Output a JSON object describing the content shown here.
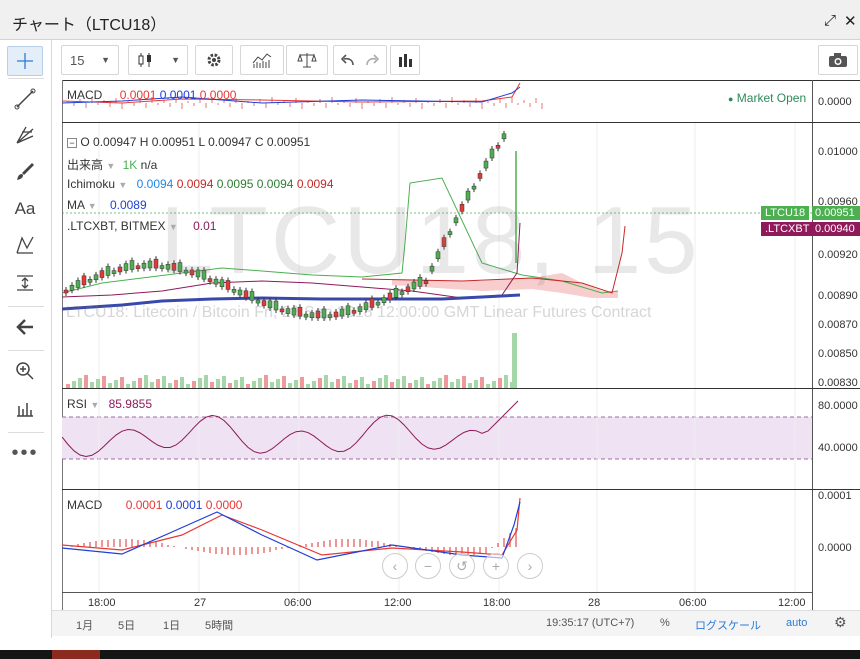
{
  "window": {
    "title": "チャート（LTCU18）"
  },
  "toolbar": {
    "interval": "15",
    "icons": [
      "candles-icon",
      "settings-icon",
      "indicators-icon",
      "compare-icon",
      "undo-icon",
      "redo-icon",
      "bar-chart-icon",
      "camera-icon"
    ]
  },
  "left_tools": [
    "crosshair-icon",
    "trendline-icon",
    "fib-icon",
    "brush-icon",
    "text-icon",
    "pattern-icon",
    "measure-icon",
    "back-arrow-icon",
    "zoom-icon",
    "ruler-icon",
    "more-icon"
  ],
  "top_macd": {
    "label": "MACD",
    "v1": "0.0001",
    "v2": "0.0001",
    "v3": "0.0000",
    "axis": "0.0000",
    "market_status": "Market Open"
  },
  "main": {
    "watermark": "LTCU18, 15",
    "subwatermark": "LTCU18: Litecoin / Bitcoin Fri, 28 Sep 2018 12:00:00 GMT Linear Futures Contract",
    "ohlc": {
      "o_label": "O",
      "o": "0.00947",
      "h_label": "H",
      "h": "0.00951",
      "l_label": "L",
      "l": "0.00947",
      "c_label": "C",
      "c": "0.00951"
    },
    "volume": {
      "label": "出来高",
      "v1": "1K",
      "v2": "n/a"
    },
    "ichimoku": {
      "label": "Ichimoku",
      "v1": "0.0094",
      "v2": "0.0094",
      "v3": "0.0095",
      "v4": "0.0094",
      "v5": "0.0094"
    },
    "ma": {
      "label": "MA",
      "value": "0.0089"
    },
    "compare": {
      "label": ".LTCXBT, BITMEX",
      "value": "0.01"
    },
    "axis_ticks": [
      "0.01000",
      "0.00960",
      "0.00920",
      "0.00890",
      "0.00870",
      "0.00850",
      "0.00830"
    ],
    "badges": [
      {
        "name": "LTCU18",
        "value": "0.00951",
        "color": "#4caf50"
      },
      {
        "name": ".LTCXBT",
        "value": "0.00940",
        "color": "#8e1a5a"
      }
    ]
  },
  "rsi": {
    "label": "RSI",
    "value": "85.9855",
    "axis_ticks": [
      "80.0000",
      "40.0000"
    ]
  },
  "bottom_macd": {
    "label": "MACD",
    "v1": "0.0001",
    "v2": "0.0001",
    "v3": "0.0000",
    "axis_ticks": [
      "0.0001",
      "0.0000"
    ]
  },
  "time_axis": [
    "18:00",
    "27",
    "06:00",
    "12:00",
    "18:00",
    "28",
    "06:00",
    "12:00"
  ],
  "bottom_bar": {
    "ranges": [
      "1月",
      "5日",
      "1日",
      "5時間"
    ],
    "clock": "19:35:17 (UTC+7)",
    "percent": "%",
    "log": "ログスケール",
    "auto": "auto"
  },
  "colors": {
    "green": "#4caf50",
    "red": "#e53935",
    "blue": "#1e88e5",
    "purple": "#8e1a5a",
    "cloud": "#f6c1c1"
  }
}
